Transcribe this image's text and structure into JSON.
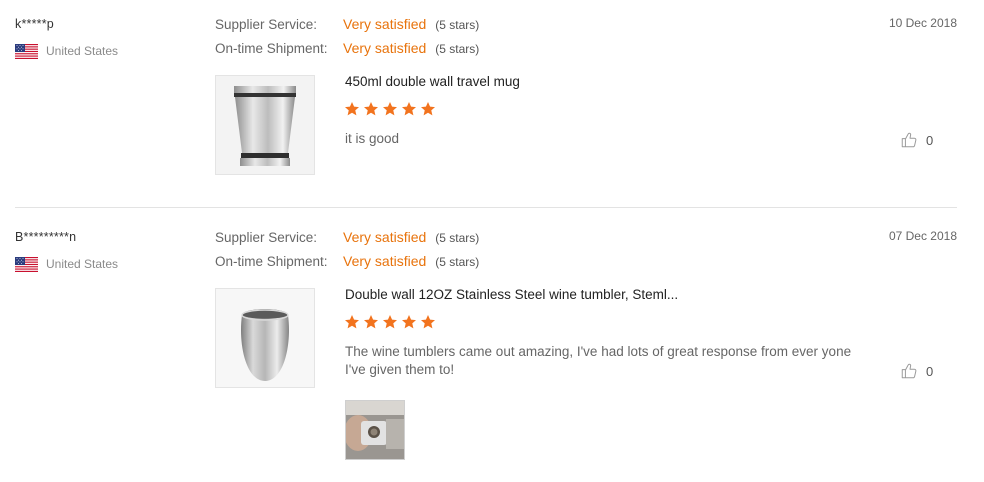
{
  "reviews": [
    {
      "user": "k*****p",
      "country": "United States",
      "supplier_service_label": "Supplier Service:",
      "supplier_service_value": "Very satisfied",
      "supplier_service_stars": "(5 stars)",
      "shipment_label": "On-time Shipment:",
      "shipment_value": "Very satisfied",
      "shipment_stars": "(5 stars)",
      "date": "10 Dec 2018",
      "product": "450ml double wall travel mug",
      "rating": 5,
      "comment": "it is good",
      "helpful_count": "0"
    },
    {
      "user": "B*********n",
      "country": "United States",
      "supplier_service_label": "Supplier Service:",
      "supplier_service_value": "Very satisfied",
      "supplier_service_stars": "(5 stars)",
      "shipment_label": "On-time Shipment:",
      "shipment_value": "Very satisfied",
      "shipment_stars": "(5 stars)",
      "date": "07 Dec 2018",
      "product": "Double wall 12OZ Stainless Steel wine tumbler, Steml...",
      "rating": 5,
      "comment": "The wine tumblers came out amazing, I've had lots of great response from ever yone I've given them to!",
      "helpful_count": "0"
    }
  ],
  "colors": {
    "accent": "#e8730c",
    "star": "#f2731e"
  },
  "icons": {
    "flag": "us-flag-icon",
    "star": "star-icon",
    "helpful": "thumbs-up-icon"
  }
}
